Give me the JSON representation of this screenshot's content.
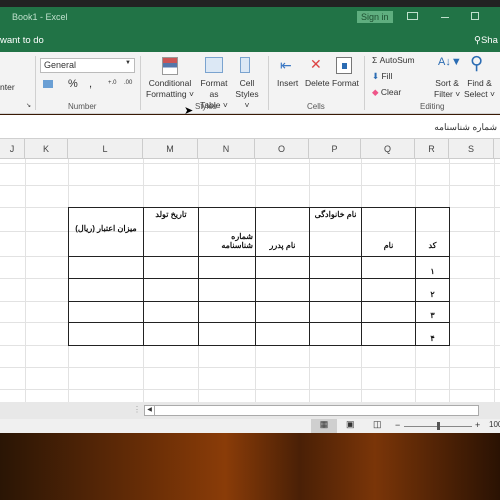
{
  "window": {
    "title": "Book1  -  Excel",
    "sign_in": "Sign in",
    "tell_me": "want to do",
    "share": "Sha"
  },
  "ribbon": {
    "alignment": {
      "merge_center": "nter"
    },
    "number": {
      "format": "General",
      "percent": "%",
      "comma": ",",
      "group": "Number"
    },
    "styles": {
      "conditional": "Conditional",
      "formatting": "Formatting",
      "format_as": "Format as",
      "table": "Table",
      "cell": "Cell",
      "styles": "Styles",
      "group": "Styles"
    },
    "cells": {
      "insert": "Insert",
      "delete": "Delete",
      "format": "Format",
      "group": "Cells"
    },
    "editing": {
      "autosum": "AutoSum",
      "fill": "Fill",
      "clear": "Clear",
      "sort": "Sort &",
      "filter": "Filter",
      "find": "Find &",
      "select": "Select",
      "group": "Editing"
    }
  },
  "formula_bar": {
    "value": "شماره شناسنامه"
  },
  "columns": [
    "J",
    "K",
    "L",
    "M",
    "N",
    "O",
    "P",
    "Q",
    "R",
    "S"
  ],
  "table": {
    "headers": [
      "میزان اعتبار (ریال)",
      "تاریخ تولد",
      "شماره شناسنامه",
      "نام پدرر",
      "نام خانوادگی",
      "نام",
      "کد"
    ],
    "codes": [
      "۱",
      "۲",
      "۳",
      "۴"
    ]
  },
  "status": {
    "zoom": "100"
  }
}
